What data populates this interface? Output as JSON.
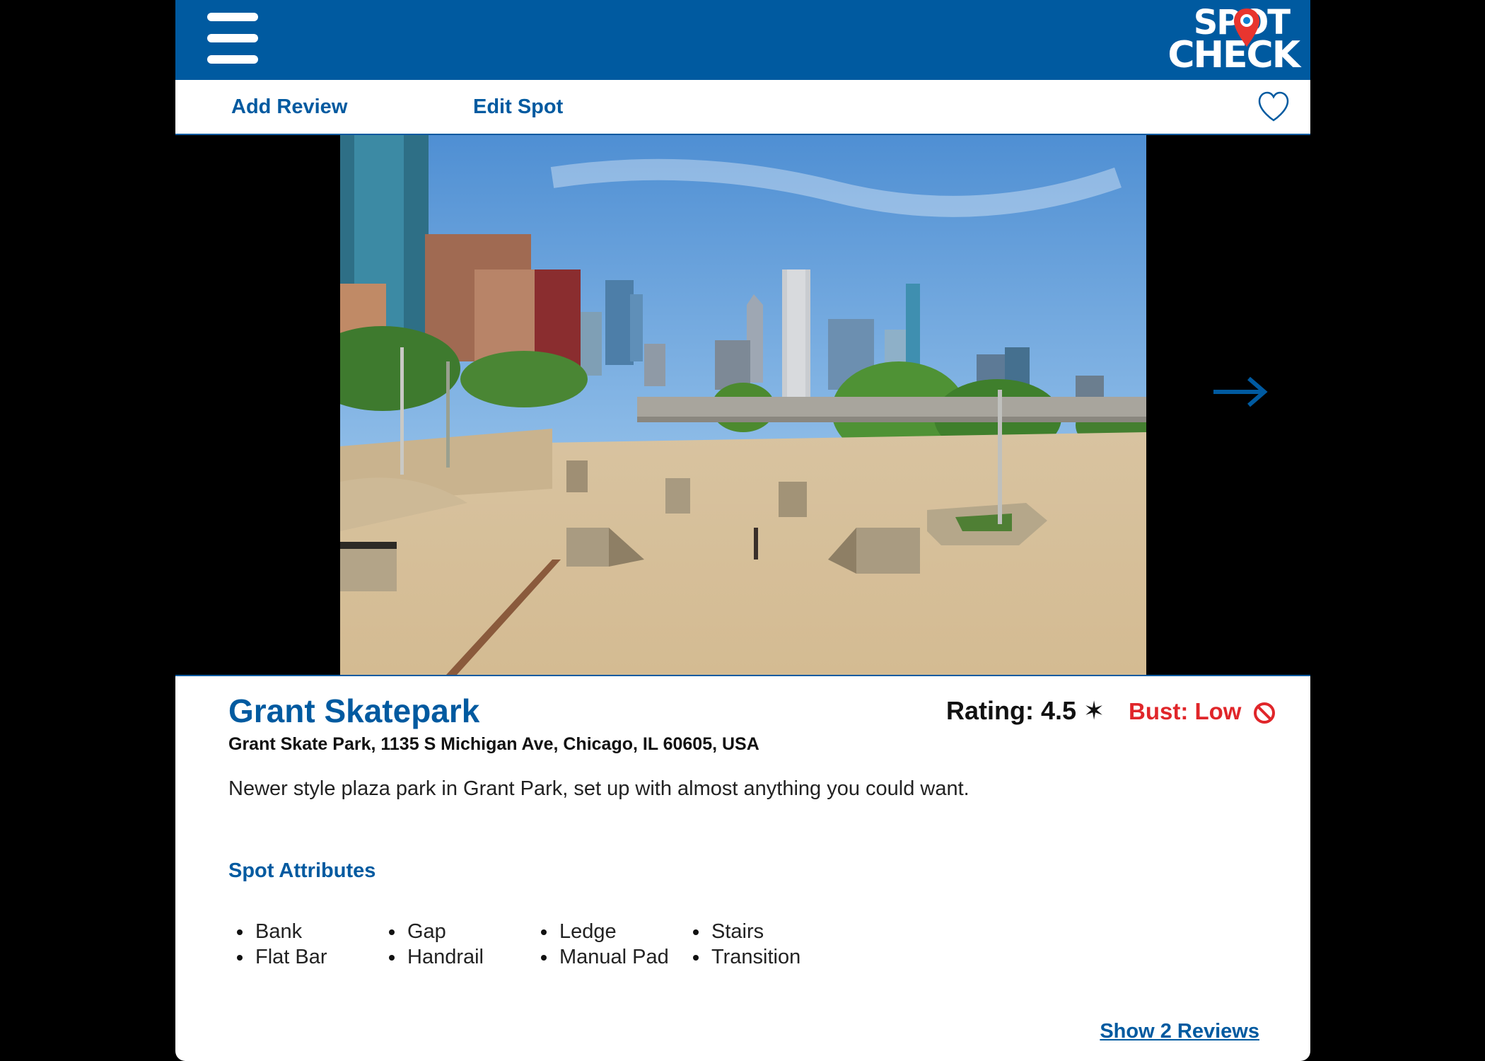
{
  "header": {
    "logo_line1": "SPOT",
    "logo_line2": "CHECK",
    "menu_icon": "hamburger-menu-icon"
  },
  "subnav": {
    "add_review": "Add Review",
    "edit_spot": "Edit Spot",
    "favorite_icon": "heart-outline-icon"
  },
  "gallery": {
    "next_icon": "arrow-right-icon"
  },
  "spot": {
    "name": "Grant Skatepark",
    "address": "Grant Skate Park, 1135 S Michigan Ave, Chicago, IL 60605, USA",
    "rating_text": "Rating: 4.5 ✶",
    "bust_text": "Bust: Low",
    "bust_icon": "prohibited-icon",
    "description": "Newer style plaza park in Grant Park, set up with almost anything you could want."
  },
  "attributes": {
    "heading": "Spot Attributes",
    "columns": [
      [
        "Bank",
        "Flat Bar"
      ],
      [
        "Gap",
        "Handrail"
      ],
      [
        "Ledge",
        "Manual Pad"
      ],
      [
        "Stairs",
        "Transition"
      ]
    ]
  },
  "reviews": {
    "show_label": "Show 2 Reviews"
  },
  "colors": {
    "brand_blue": "#005aa0",
    "bust_red": "#e0262a",
    "logo_pin_red": "#e8352f"
  }
}
